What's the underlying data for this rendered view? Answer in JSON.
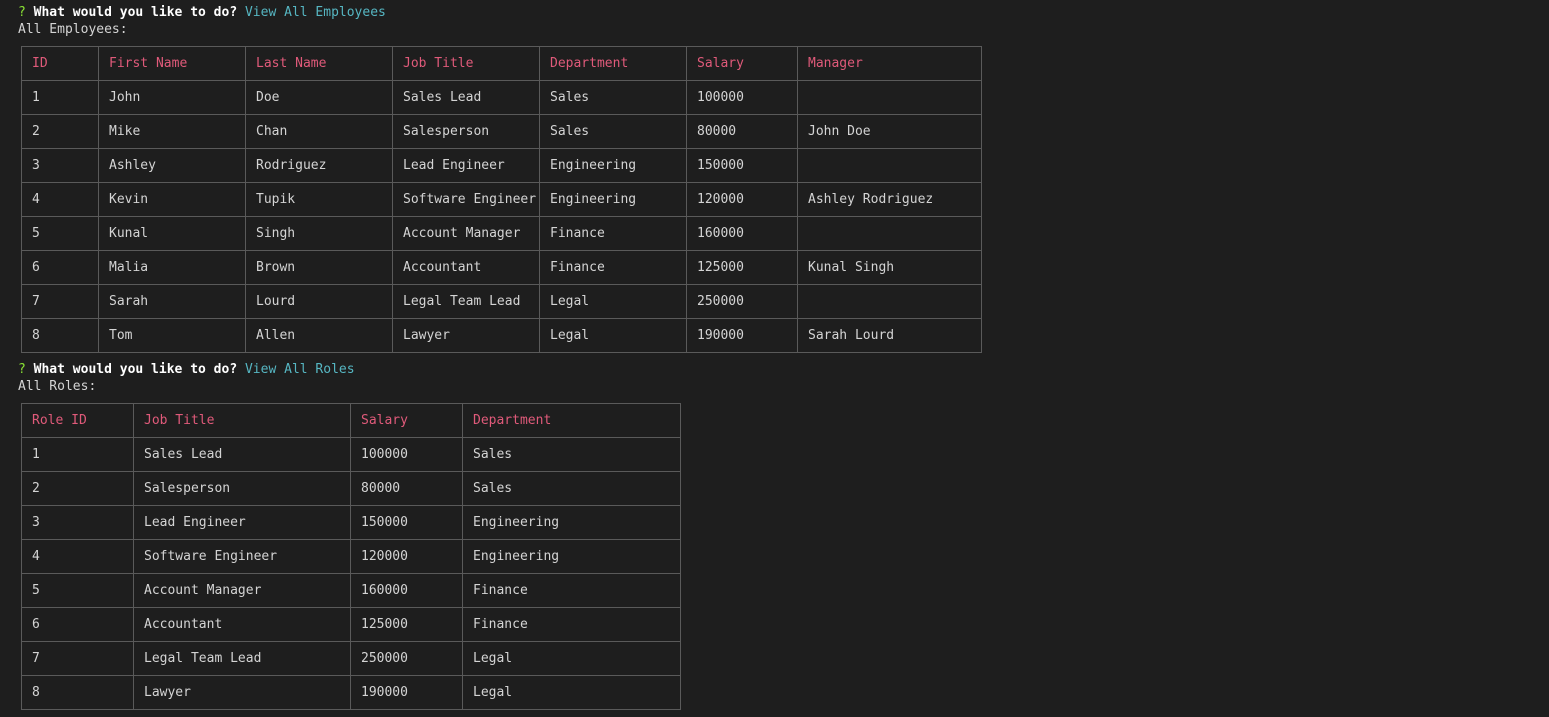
{
  "colors": {
    "background": "#1e1e1e",
    "header_text": "#e05a7a",
    "answer_text": "#56b6c2",
    "question_mark": "#8ae234",
    "border": "#5a5a5a"
  },
  "prompt1": {
    "mark": "?",
    "question": "What would you like to do?",
    "answer": "View All Employees"
  },
  "employees_label": "All Employees:",
  "employees_table": {
    "headers": [
      "ID",
      "First Name",
      "Last Name",
      "Job Title",
      "Department",
      "Salary",
      "Manager"
    ],
    "rows": [
      [
        "1",
        "John",
        "Doe",
        "Sales Lead",
        "Sales",
        "100000",
        ""
      ],
      [
        "2",
        "Mike",
        "Chan",
        "Salesperson",
        "Sales",
        "80000",
        "John Doe"
      ],
      [
        "3",
        "Ashley",
        "Rodriguez",
        "Lead Engineer",
        "Engineering",
        "150000",
        ""
      ],
      [
        "4",
        "Kevin",
        "Tupik",
        "Software Engineer",
        "Engineering",
        "120000",
        "Ashley Rodriguez"
      ],
      [
        "5",
        "Kunal",
        "Singh",
        "Account Manager",
        "Finance",
        "160000",
        ""
      ],
      [
        "6",
        "Malia",
        "Brown",
        "Accountant",
        "Finance",
        "125000",
        "Kunal Singh"
      ],
      [
        "7",
        "Sarah",
        "Lourd",
        "Legal Team Lead",
        "Legal",
        "250000",
        ""
      ],
      [
        "8",
        "Tom",
        "Allen",
        "Lawyer",
        "Legal",
        "190000",
        "Sarah Lourd"
      ]
    ]
  },
  "prompt2": {
    "mark": "?",
    "question": "What would you like to do?",
    "answer": "View All Roles"
  },
  "roles_label": "All Roles:",
  "roles_table": {
    "headers": [
      "Role ID",
      "Job Title",
      "Salary",
      "Department"
    ],
    "rows": [
      [
        "1",
        "Sales Lead",
        "100000",
        "Sales"
      ],
      [
        "2",
        "Salesperson",
        "80000",
        "Sales"
      ],
      [
        "3",
        "Lead Engineer",
        "150000",
        "Engineering"
      ],
      [
        "4",
        "Software Engineer",
        "120000",
        "Engineering"
      ],
      [
        "5",
        "Account Manager",
        "160000",
        "Finance"
      ],
      [
        "6",
        "Accountant",
        "125000",
        "Finance"
      ],
      [
        "7",
        "Legal Team Lead",
        "250000",
        "Legal"
      ],
      [
        "8",
        "Lawyer",
        "190000",
        "Legal"
      ]
    ]
  }
}
